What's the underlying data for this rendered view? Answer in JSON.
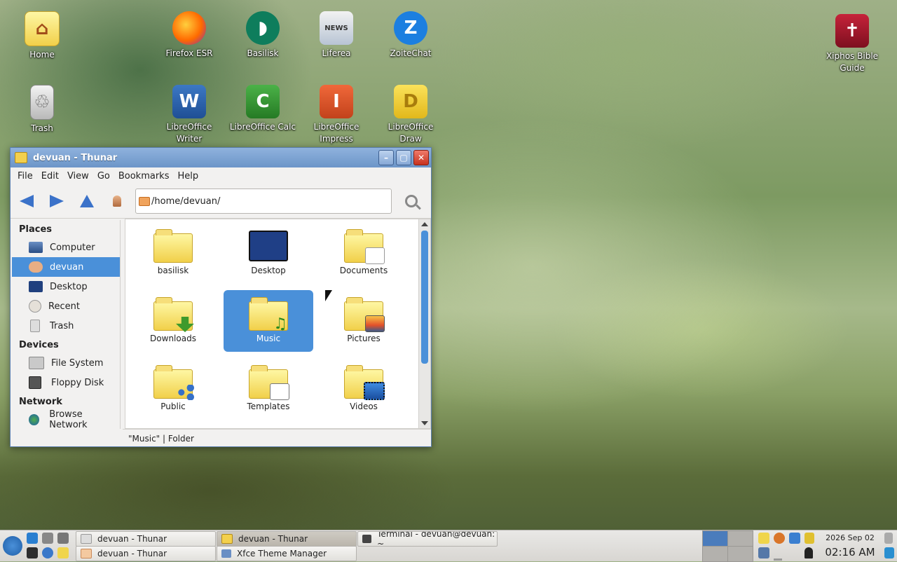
{
  "desktop": {
    "icons": [
      {
        "label": "Home",
        "icon": "home-folder-icon"
      },
      {
        "label": "Firefox ESR",
        "icon": "firefox-icon"
      },
      {
        "label": "Basilisk",
        "icon": "basilisk-icon"
      },
      {
        "label": "Liferea",
        "icon": "liferea-news-icon"
      },
      {
        "label": "ZoiteChat",
        "icon": "zoitechat-icon"
      },
      {
        "label": "Xiphos Bible Guide",
        "icon": "xiphos-bible-icon"
      },
      {
        "label": "Trash",
        "icon": "trash-icon"
      },
      {
        "label": "LibreOffice Writer",
        "icon": "libreoffice-writer-icon"
      },
      {
        "label": "LibreOffice Calc",
        "icon": "libreoffice-calc-icon"
      },
      {
        "label": "LibreOffice Impress",
        "icon": "libreoffice-impress-icon"
      },
      {
        "label": "LibreOffice Draw",
        "icon": "libreoffice-draw-icon"
      }
    ]
  },
  "window": {
    "title": "devuan - Thunar",
    "menu": [
      "File",
      "Edit",
      "View",
      "Go",
      "Bookmarks",
      "Help"
    ],
    "path": "/home/devuan/",
    "sidebar": {
      "places_title": "Places",
      "places": [
        "Computer",
        "devuan",
        "Desktop",
        "Recent",
        "Trash"
      ],
      "devices_title": "Devices",
      "devices": [
        "File System",
        "Floppy Disk"
      ],
      "network_title": "Network",
      "network": [
        "Browse Network"
      ]
    },
    "files": [
      "basilisk",
      "Desktop",
      "Documents",
      "Downloads",
      "Music",
      "Pictures",
      "Public",
      "Templates",
      "Videos"
    ],
    "status": "\"Music\"  |  Folder"
  },
  "panel": {
    "tasks_row1": [
      "devuan - Thunar",
      "devuan - Thunar",
      "Terminal - devuan@devuan: ~"
    ],
    "tasks_row2": [
      "devuan - Thunar",
      "Xfce Theme Manager"
    ],
    "date": "2026 Sep 02",
    "time": "02:16 AM"
  },
  "colors": {
    "selection": "#4a90d9",
    "titlebar": "#7a9fd0",
    "close": "#d9442f"
  }
}
